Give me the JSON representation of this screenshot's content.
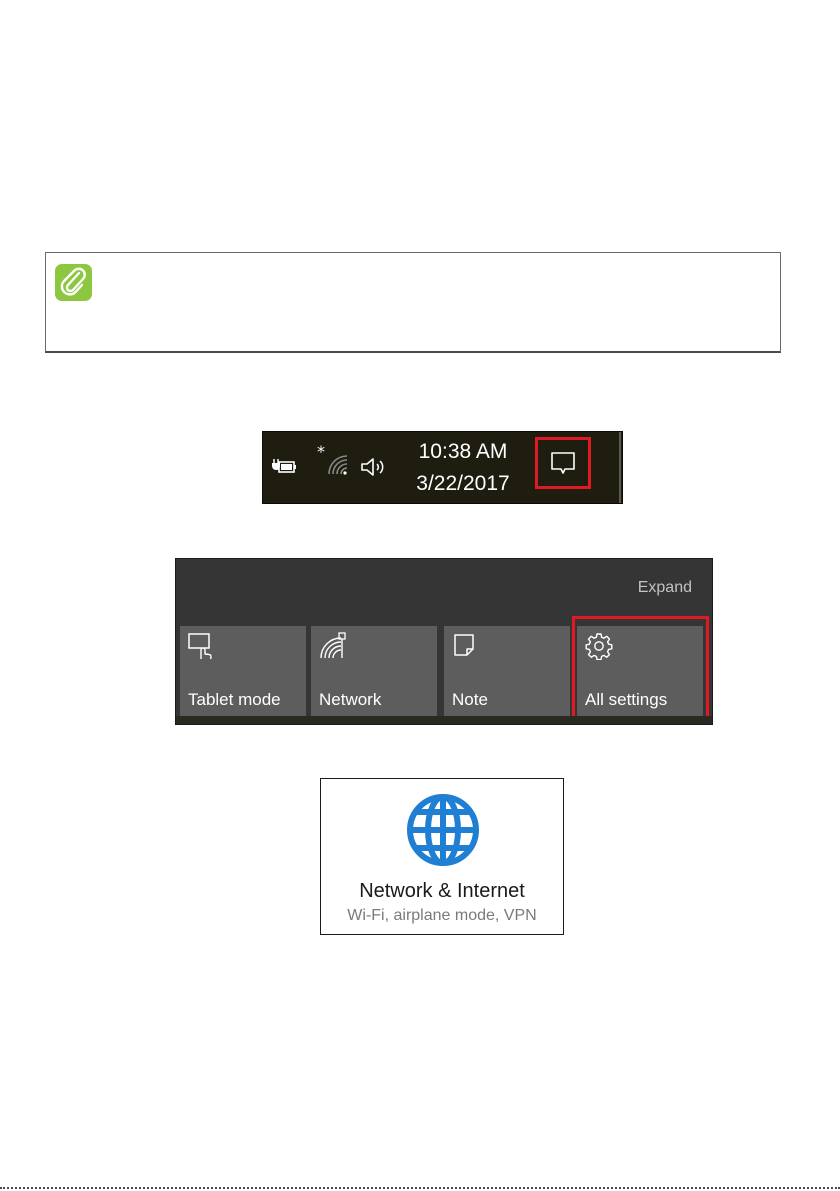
{
  "taskbar": {
    "time": "10:38 AM",
    "date": "3/22/2017",
    "icons": [
      "battery-charging-icon",
      "wifi-icon",
      "volume-icon",
      "action-center-icon"
    ]
  },
  "action_center": {
    "expand_label": "Expand",
    "tiles": [
      {
        "label": "Tablet mode",
        "icon": "tablet-mode-icon"
      },
      {
        "label": "Network",
        "icon": "network-icon"
      },
      {
        "label": "Note",
        "icon": "note-icon"
      },
      {
        "label": "All settings",
        "icon": "gear-icon"
      }
    ]
  },
  "settings_card": {
    "title": "Network & Internet",
    "subtitle": "Wi-Fi, airplane mode, VPN",
    "icon": "globe-icon"
  },
  "colors": {
    "highlight": "#e01a22",
    "note_icon": "#8dc63f",
    "globe": "#1f7fd3",
    "tile": "#5d5d5d",
    "panel": "#353535",
    "taskbar": "#1e1d10"
  }
}
